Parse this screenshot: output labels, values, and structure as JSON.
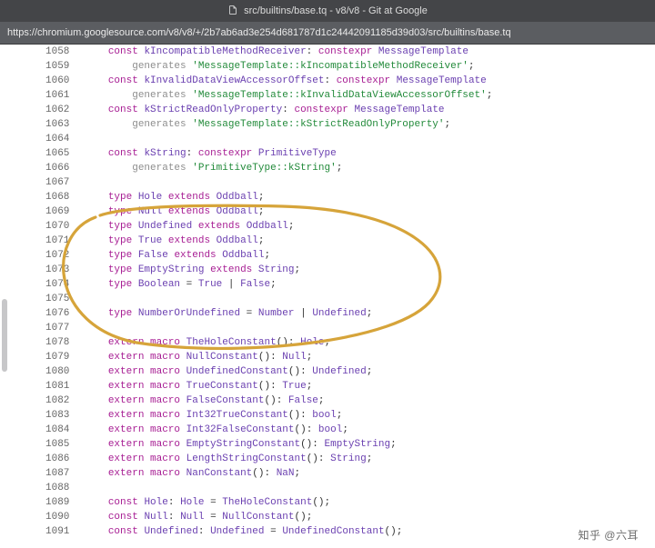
{
  "titlebar": {
    "text": "src/builtins/base.tq - v8/v8 - Git at Google"
  },
  "url": "https://chromium.googlesource.com/v8/v8/+/2b7ab6ad3e254d681787d1c24442091185d39d03/src/builtins/base.tq",
  "watermark": "知乎 @六耳",
  "code": [
    {
      "n": 1058,
      "indent": 1,
      "kind": "const-decl",
      "name": "kIncompatibleMethodReceiver",
      "type_kw": "constexpr",
      "type": "MessageTemplate"
    },
    {
      "n": 1059,
      "indent": 2,
      "kind": "generates",
      "value": "'MessageTemplate::kIncompatibleMethodReceiver'"
    },
    {
      "n": 1060,
      "indent": 1,
      "kind": "const-decl",
      "name": "kInvalidDataViewAccessorOffset",
      "type_kw": "constexpr",
      "type": "MessageTemplate"
    },
    {
      "n": 1061,
      "indent": 2,
      "kind": "generates",
      "value": "'MessageTemplate::kInvalidDataViewAccessorOffset'"
    },
    {
      "n": 1062,
      "indent": 1,
      "kind": "const-decl",
      "name": "kStrictReadOnlyProperty",
      "type_kw": "constexpr",
      "type": "MessageTemplate"
    },
    {
      "n": 1063,
      "indent": 2,
      "kind": "generates",
      "value": "'MessageTemplate::kStrictReadOnlyProperty'"
    },
    {
      "n": 1064,
      "indent": 0,
      "kind": "blank"
    },
    {
      "n": 1065,
      "indent": 1,
      "kind": "const-decl",
      "name": "kString",
      "type_kw": "constexpr",
      "type": "PrimitiveType"
    },
    {
      "n": 1066,
      "indent": 2,
      "kind": "generates",
      "value": "'PrimitiveType::kString'"
    },
    {
      "n": 1067,
      "indent": 0,
      "kind": "blank"
    },
    {
      "n": 1068,
      "indent": 1,
      "kind": "type-extends",
      "name": "Hole",
      "base": "Oddball"
    },
    {
      "n": 1069,
      "indent": 1,
      "kind": "type-extends",
      "name": "Null",
      "base": "Oddball"
    },
    {
      "n": 1070,
      "indent": 1,
      "kind": "type-extends",
      "name": "Undefined",
      "base": "Oddball"
    },
    {
      "n": 1071,
      "indent": 1,
      "kind": "type-extends",
      "name": "True",
      "base": "Oddball"
    },
    {
      "n": 1072,
      "indent": 1,
      "kind": "type-extends",
      "name": "False",
      "base": "Oddball"
    },
    {
      "n": 1073,
      "indent": 1,
      "kind": "type-extends",
      "name": "EmptyString",
      "base": "String"
    },
    {
      "n": 1074,
      "indent": 1,
      "kind": "type-union",
      "name": "Boolean",
      "members": [
        "True",
        "False"
      ]
    },
    {
      "n": 1075,
      "indent": 0,
      "kind": "blank"
    },
    {
      "n": 1076,
      "indent": 1,
      "kind": "type-union",
      "name": "NumberOrUndefined",
      "members": [
        "Number",
        "Undefined"
      ]
    },
    {
      "n": 1077,
      "indent": 0,
      "kind": "blank"
    },
    {
      "n": 1078,
      "indent": 1,
      "kind": "extern-macro",
      "name": "TheHoleConstant",
      "ret": "Hole"
    },
    {
      "n": 1079,
      "indent": 1,
      "kind": "extern-macro",
      "name": "NullConstant",
      "ret": "Null"
    },
    {
      "n": 1080,
      "indent": 1,
      "kind": "extern-macro",
      "name": "UndefinedConstant",
      "ret": "Undefined"
    },
    {
      "n": 1081,
      "indent": 1,
      "kind": "extern-macro",
      "name": "TrueConstant",
      "ret": "True"
    },
    {
      "n": 1082,
      "indent": 1,
      "kind": "extern-macro",
      "name": "FalseConstant",
      "ret": "False"
    },
    {
      "n": 1083,
      "indent": 1,
      "kind": "extern-macro",
      "name": "Int32TrueConstant",
      "ret": "bool"
    },
    {
      "n": 1084,
      "indent": 1,
      "kind": "extern-macro",
      "name": "Int32FalseConstant",
      "ret": "bool"
    },
    {
      "n": 1085,
      "indent": 1,
      "kind": "extern-macro",
      "name": "EmptyStringConstant",
      "ret": "EmptyString"
    },
    {
      "n": 1086,
      "indent": 1,
      "kind": "extern-macro",
      "name": "LengthStringConstant",
      "ret": "String"
    },
    {
      "n": 1087,
      "indent": 1,
      "kind": "extern-macro",
      "name": "NanConstant",
      "ret": "NaN"
    },
    {
      "n": 1088,
      "indent": 0,
      "kind": "blank"
    },
    {
      "n": 1089,
      "indent": 1,
      "kind": "const-assign",
      "name": "Hole",
      "type": "Hole",
      "call": "TheHoleConstant"
    },
    {
      "n": 1090,
      "indent": 1,
      "kind": "const-assign",
      "name": "Null",
      "type": "Null",
      "call": "NullConstant"
    },
    {
      "n": 1091,
      "indent": 1,
      "kind": "const-assign",
      "name": "Undefined",
      "type": "Undefined",
      "call": "UndefinedConstant"
    }
  ]
}
